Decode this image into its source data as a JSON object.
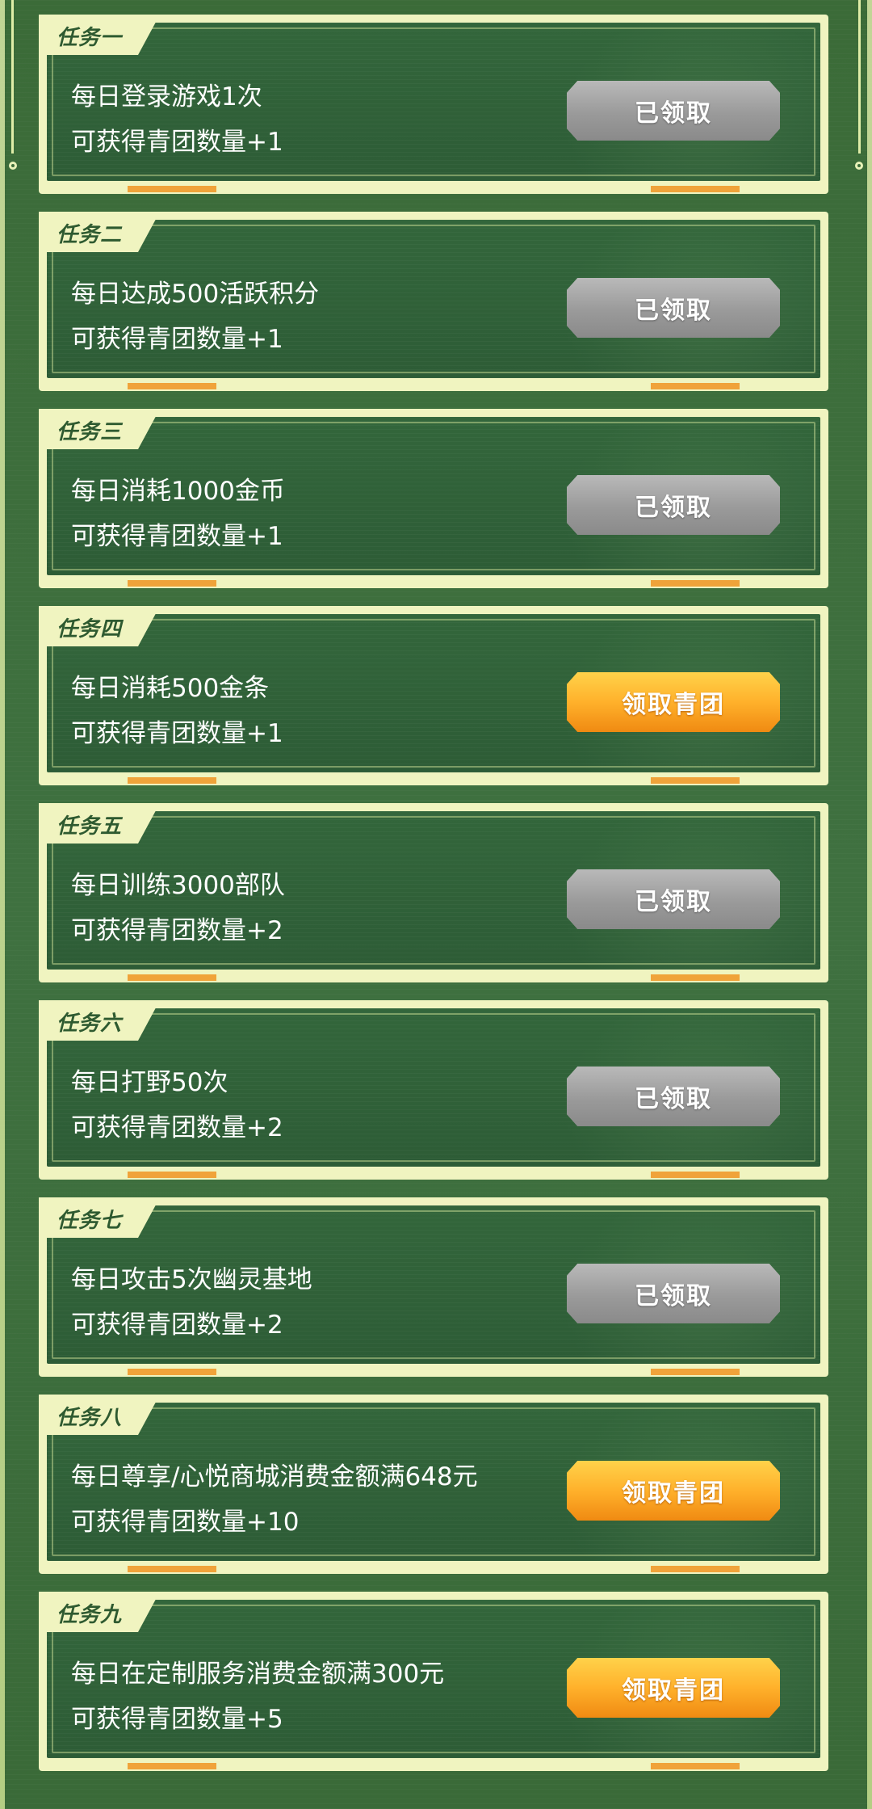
{
  "tasks": [
    {
      "title": "任务一",
      "desc": "每日登录游戏1次",
      "reward": "可获得青团数量+1",
      "button": "已领取",
      "state": "done"
    },
    {
      "title": "任务二",
      "desc": "每日达成500活跃积分",
      "reward": "可获得青团数量+1",
      "button": "已领取",
      "state": "done"
    },
    {
      "title": "任务三",
      "desc": "每日消耗1000金币",
      "reward": "可获得青团数量+1",
      "button": "已领取",
      "state": "done"
    },
    {
      "title": "任务四",
      "desc": "每日消耗500金条",
      "reward": "可获得青团数量+1",
      "button": "领取青团",
      "state": "claim"
    },
    {
      "title": "任务五",
      "desc": "每日训练3000部队",
      "reward": "可获得青团数量+2",
      "button": "已领取",
      "state": "done"
    },
    {
      "title": "任务六",
      "desc": "每日打野50次",
      "reward": "可获得青团数量+2",
      "button": "已领取",
      "state": "done"
    },
    {
      "title": "任务七",
      "desc": "每日攻击5次幽灵基地",
      "reward": "可获得青团数量+2",
      "button": "已领取",
      "state": "done"
    },
    {
      "title": "任务八",
      "desc": "每日尊享/心悦商城消费金额满648元",
      "reward": "可获得青团数量+10",
      "button": "领取青团",
      "state": "claim"
    },
    {
      "title": "任务九",
      "desc": "每日在定制服务消费金额满300元",
      "reward": "可获得青团数量+5",
      "button": "领取青团",
      "state": "claim"
    }
  ],
  "colors": {
    "background": "#3d6e3a",
    "card_inner": "#2f5f37",
    "frame": "#f0f4c0",
    "button_done": "#9a9a9a",
    "button_claim": "#ffb12b",
    "accent_bar": "#f0a33a"
  }
}
